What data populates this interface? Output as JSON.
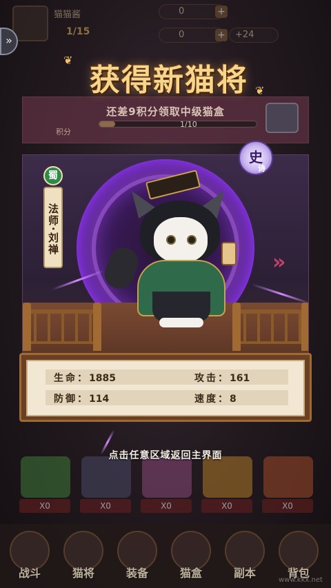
{
  "header": {
    "player_name": "猫猫酱",
    "player_level": "1/15",
    "coin": "0",
    "gem": "0",
    "energy": "+24",
    "plus": "+",
    "nav_toggle": "»"
  },
  "banner": {
    "title": "获得新猫将"
  },
  "box_progress": {
    "hint": "还差9积分领取中级猫盒",
    "points_label": "积分",
    "progress_text": "1/10",
    "progress_fraction": 0.1
  },
  "character": {
    "faction": "蜀",
    "class_name": "法师·刘禅",
    "rarity": "史",
    "rarity_sub": "诗",
    "nav_left": "«",
    "nav_right": "»"
  },
  "stats": {
    "hp_label": "生命：",
    "hp_value": "1885",
    "atk_label": "攻击：",
    "atk_value": "161",
    "def_label": "防御：",
    "def_value": "114",
    "spd_label": "速度：",
    "spd_value": "8"
  },
  "return_hint": "点击任意区域返回主界面",
  "chests": [
    {
      "count": "X0",
      "color": "#3f7a3a"
    },
    {
      "count": "X0",
      "color": "#4a4a66"
    },
    {
      "count": "X0",
      "color": "#8a4a7a"
    },
    {
      "count": "X0",
      "color": "#b07a2a"
    },
    {
      "count": "X0",
      "color": "#a04a2a"
    }
  ],
  "nav": [
    {
      "label": "战斗"
    },
    {
      "label": "猫将"
    },
    {
      "label": "装备"
    },
    {
      "label": "猫盒"
    },
    {
      "label": "副本"
    },
    {
      "label": "背包"
    }
  ],
  "watermark": "www.kkx.net"
}
